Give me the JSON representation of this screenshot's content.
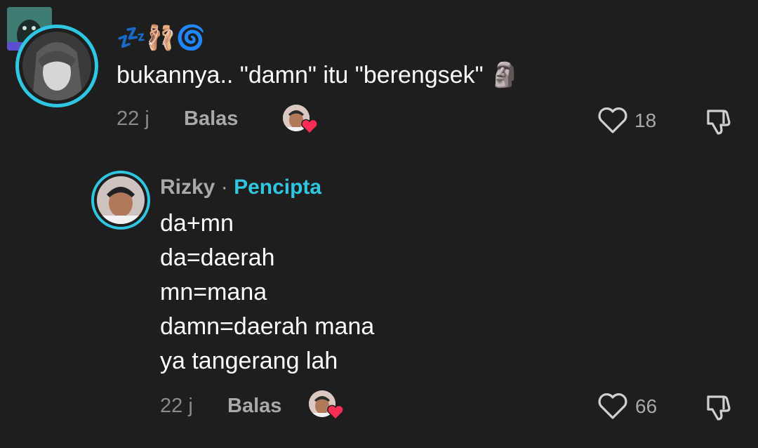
{
  "comment": {
    "username_emojis": "💤🩰🌀",
    "text": "bukannya.. \"damn\" itu \"berengsek\" 🗿",
    "time": "22 j",
    "reply_label": "Balas",
    "like_count": "18"
  },
  "reply": {
    "username": "Rizky",
    "separator": "·",
    "role": "Pencipta",
    "lines": [
      "da+mn",
      "da=daerah",
      "mn=mana",
      "damn=daerah mana",
      "ya tangerang lah"
    ],
    "time": "22 j",
    "reply_label": "Balas",
    "like_count": "66"
  },
  "colors": {
    "background": "#1e1e1e",
    "accent": "#2ec6e0",
    "heart_badge": "#fe2c55"
  }
}
